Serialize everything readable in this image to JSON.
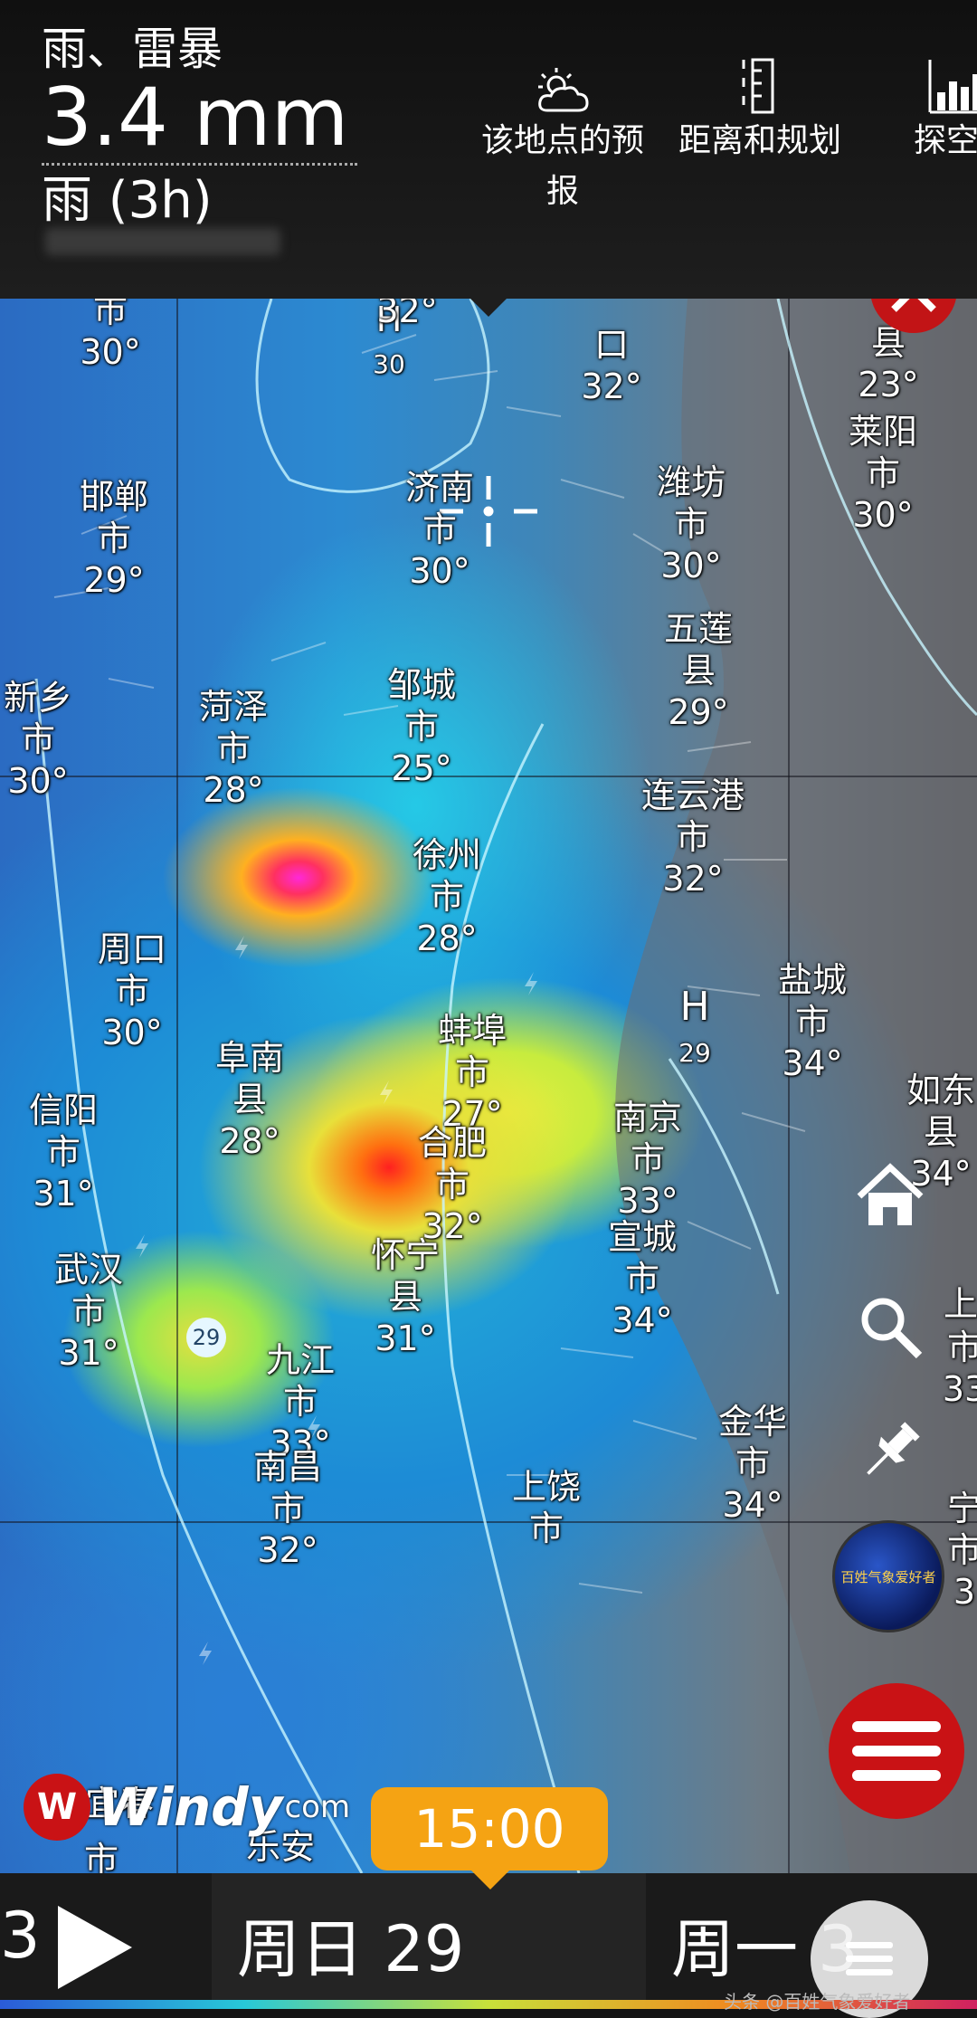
{
  "header": {
    "weather_type": "雨、雷暴",
    "amount": "3.4 mm",
    "period": "雨 (3h)",
    "buttons": [
      {
        "label": "该地点的预报",
        "icon": "weather-cloud-sun-icon"
      },
      {
        "label": "距离和规划",
        "icon": "ruler-icon"
      },
      {
        "label": "探空",
        "icon": "bar-chart-icon"
      }
    ]
  },
  "map": {
    "pressure_labels": [
      {
        "letter": "H",
        "value": "30"
      },
      {
        "letter": "H",
        "value": "29"
      }
    ],
    "isobar_marker": "29",
    "cities": [
      {
        "name": "市",
        "temp": "30°"
      },
      {
        "name": "市",
        "temp": "32°"
      },
      {
        "name": "口",
        "temp": "32°"
      },
      {
        "name": "县",
        "temp": "23°"
      },
      {
        "name": "莱阳",
        "type": "市",
        "temp": "30°"
      },
      {
        "name": "邯郸",
        "type": "市",
        "temp": "29°"
      },
      {
        "name": "济南",
        "type": "市",
        "temp": "30°"
      },
      {
        "name": "潍坊",
        "type": "市",
        "temp": "30°"
      },
      {
        "name": "五莲",
        "type": "县",
        "temp": "29°"
      },
      {
        "name": "新乡",
        "type": "市",
        "temp": "30°"
      },
      {
        "name": "菏泽",
        "type": "市",
        "temp": "28°"
      },
      {
        "name": "邹城",
        "type": "市",
        "temp": "25°"
      },
      {
        "name": "连云港",
        "type": "市",
        "temp": "32°"
      },
      {
        "name": "徐州",
        "type": "市",
        "temp": "28°"
      },
      {
        "name": "周口",
        "type": "市",
        "temp": "30°"
      },
      {
        "name": "盐城",
        "type": "市",
        "temp": "34°"
      },
      {
        "name": "阜南",
        "type": "县",
        "temp": "28°"
      },
      {
        "name": "蚌埠",
        "type": "市",
        "temp": "27°"
      },
      {
        "name": "如东",
        "type": "县",
        "temp": "34°"
      },
      {
        "name": "信阳",
        "type": "市",
        "temp": "31°"
      },
      {
        "name": "合肥",
        "type": "市",
        "temp": "32°"
      },
      {
        "name": "南京",
        "type": "市",
        "temp": "33°"
      },
      {
        "name": "怀宁",
        "type": "县",
        "temp": "31°"
      },
      {
        "name": "宣城",
        "type": "市",
        "temp": "34°"
      },
      {
        "name": "武汉",
        "type": "市",
        "temp": "31°"
      },
      {
        "name": "九江",
        "type": "市",
        "temp": "33°"
      },
      {
        "name": "金华",
        "type": "市",
        "temp": "34°"
      },
      {
        "name": "南昌",
        "type": "市",
        "temp": "32°"
      },
      {
        "name": "上饶",
        "type": "市"
      },
      {
        "name": "乐安"
      },
      {
        "name": "上"
      },
      {
        "name": "市",
        "temp": "33"
      },
      {
        "name": "宁",
        "type": "市",
        "temp": "3"
      },
      {
        "name": "市"
      },
      {
        "name": "市"
      },
      {
        "name": "宜春"
      }
    ],
    "globe_label": "百姓气象爱好者",
    "logo_text": "Windy",
    "logo_suffix": "com"
  },
  "timeline": {
    "current_time": "15:00",
    "prev_day_fragment": "3",
    "current_day": "周日 29",
    "next_day": "周一 3"
  },
  "watermark": "头条 @百姓气象爱好者",
  "colors": {
    "accent_red": "#c91215",
    "time_badge": "#f5a313",
    "header_bg": "#141414"
  }
}
